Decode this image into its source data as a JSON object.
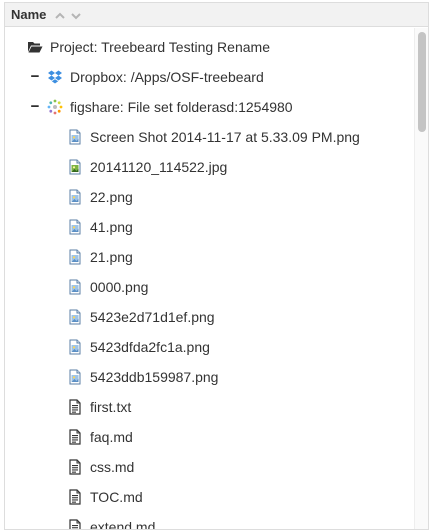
{
  "header": {
    "title": "Name"
  },
  "tree": {
    "project": {
      "label": "Project: Treebeard Testing Rename"
    },
    "dropbox": {
      "toggle": "−",
      "label": "Dropbox: /Apps/OSF-treebeard"
    },
    "figshare": {
      "toggle": "−",
      "label": "figshare: File set folderasd:1254980"
    },
    "files": [
      {
        "name": "Screen Shot 2014-11-17 at 5.33.09 PM.png",
        "icon": "image-file-icon"
      },
      {
        "name": "20141120_114522.jpg",
        "icon": "photo-file-icon"
      },
      {
        "name": "22.png",
        "icon": "image-file-icon"
      },
      {
        "name": "41.png",
        "icon": "image-file-icon"
      },
      {
        "name": "21.png",
        "icon": "image-file-icon"
      },
      {
        "name": "0000.png",
        "icon": "image-file-icon"
      },
      {
        "name": "5423e2d71d1ef.png",
        "icon": "image-file-icon"
      },
      {
        "name": "5423dfda2fc1a.png",
        "icon": "image-file-icon"
      },
      {
        "name": "5423ddb159987.png",
        "icon": "image-file-icon"
      },
      {
        "name": "first.txt",
        "icon": "text-file-icon"
      },
      {
        "name": "faq.md",
        "icon": "text-file-icon"
      },
      {
        "name": "css.md",
        "icon": "text-file-icon"
      },
      {
        "name": "TOC.md",
        "icon": "text-file-icon"
      },
      {
        "name": "extend.md",
        "icon": "text-file-icon"
      }
    ]
  },
  "colors": {
    "header_bg": "#f2f2f2",
    "border": "#dddddd",
    "dropbox_blue": "#3d8fe0",
    "scroll_thumb": "#c4c4c4"
  }
}
